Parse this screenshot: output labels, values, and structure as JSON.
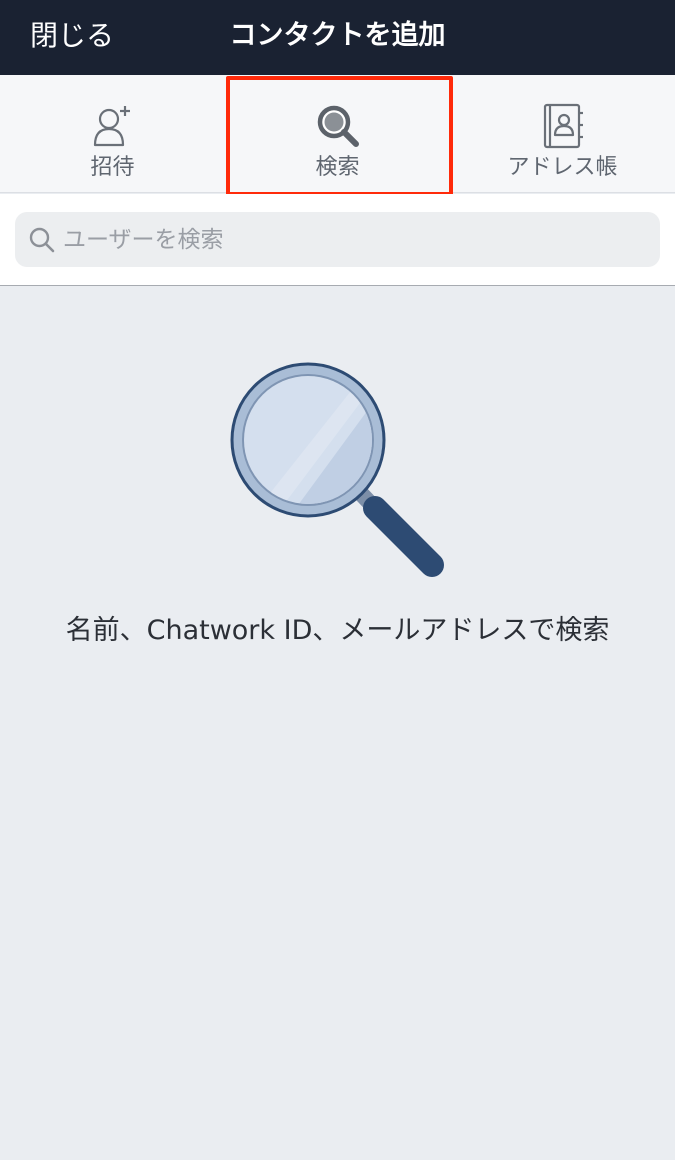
{
  "navbar": {
    "close_label": "閉じる",
    "title": "コンタクトを追加"
  },
  "tabs": [
    {
      "label": "招待",
      "icon": "add-user-icon"
    },
    {
      "label": "検索",
      "icon": "search-icon"
    },
    {
      "label": "アドレス帳",
      "icon": "address-book-icon"
    }
  ],
  "selected_tab": "検索",
  "search": {
    "placeholder": "ユーザーを検索",
    "value": ""
  },
  "empty_state": {
    "illustration": "magnifying-glass-icon",
    "message": "名前、Chatwork ID、メールアドレスで検索"
  },
  "colors": {
    "navbar_bg": "#1a2232",
    "highlight": "#ff2a0a",
    "background": "#eaedf1"
  }
}
